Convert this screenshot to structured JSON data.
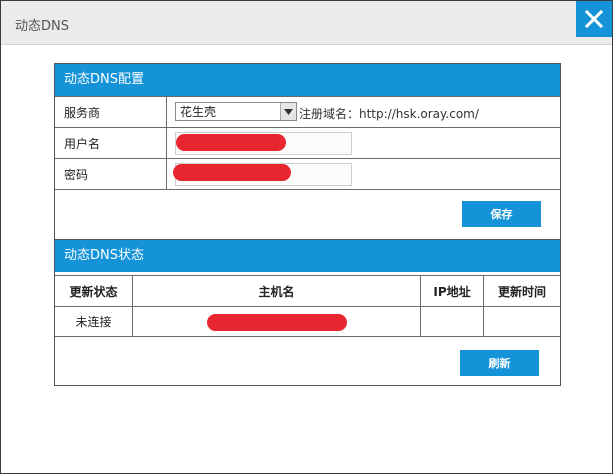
{
  "window": {
    "title": "动态DNS",
    "close_icon": "close-icon"
  },
  "config": {
    "heading": "动态DNS配置",
    "provider_label": "服务商",
    "provider_value": "花生壳",
    "domain_hint": "注册域名：http://hsk.oray.com/",
    "username_label": "用户名",
    "password_label": "密码",
    "save_label": "保存"
  },
  "status": {
    "heading": "动态DNS状态",
    "columns": [
      "更新状态",
      "主机名",
      "IP地址",
      "更新时间"
    ],
    "row": {
      "state": "未连接",
      "ip": "",
      "time": ""
    },
    "refresh_label": "刷新"
  },
  "colors": {
    "accent": "#1593d9",
    "redaction": "#e8262f"
  }
}
